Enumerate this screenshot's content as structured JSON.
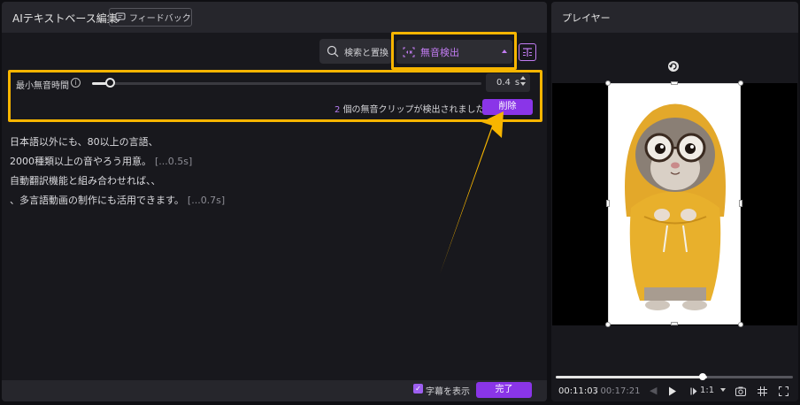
{
  "left_panel": {
    "title": "AIテキストベース編集",
    "feedback_label": "フィードバック",
    "search_replace_label": "検索と置換",
    "silence_detect_label": "無音検出",
    "min_silence_label": "最小無音時間",
    "min_silence_value": "0.4",
    "min_silence_unit": "s",
    "min_silence_fraction": 0.04,
    "detected_count": "2",
    "detected_text": "個の無音クリップが検出されました",
    "delete_label": "削除",
    "transcript": [
      {
        "text": "日本語以外にも、80以上の言語、",
        "gap": ""
      },
      {
        "text": "2000種類以上の音やろう用意。",
        "gap": "[...0.5s]"
      },
      {
        "text": "自動翻訳機能と組み合わせれば、、",
        "gap": ""
      },
      {
        "text": "、多言語動画の制作にも活用できます。",
        "gap": "[...0.7s]"
      }
    ],
    "show_subtitles_label": "字幕を表示",
    "show_subtitles_checked": true,
    "done_label": "完了"
  },
  "player": {
    "title": "プレイヤー",
    "current_time": "00:11:03",
    "total_time": "/ 00:17:21",
    "progress_fraction": 0.637,
    "zoom_label": "1:1"
  },
  "colors": {
    "accent": "#8a35e8",
    "highlight": "#f7b500",
    "purple_text": "#c27cf2"
  },
  "icons": [
    "feedback-icon",
    "search-icon",
    "silence-icon",
    "text-layout-icon",
    "info-icon",
    "rotate-icon",
    "play-icon",
    "prev-frame-icon",
    "next-frame-icon",
    "snapshot-icon",
    "grid-icon",
    "fullscreen-icon"
  ]
}
